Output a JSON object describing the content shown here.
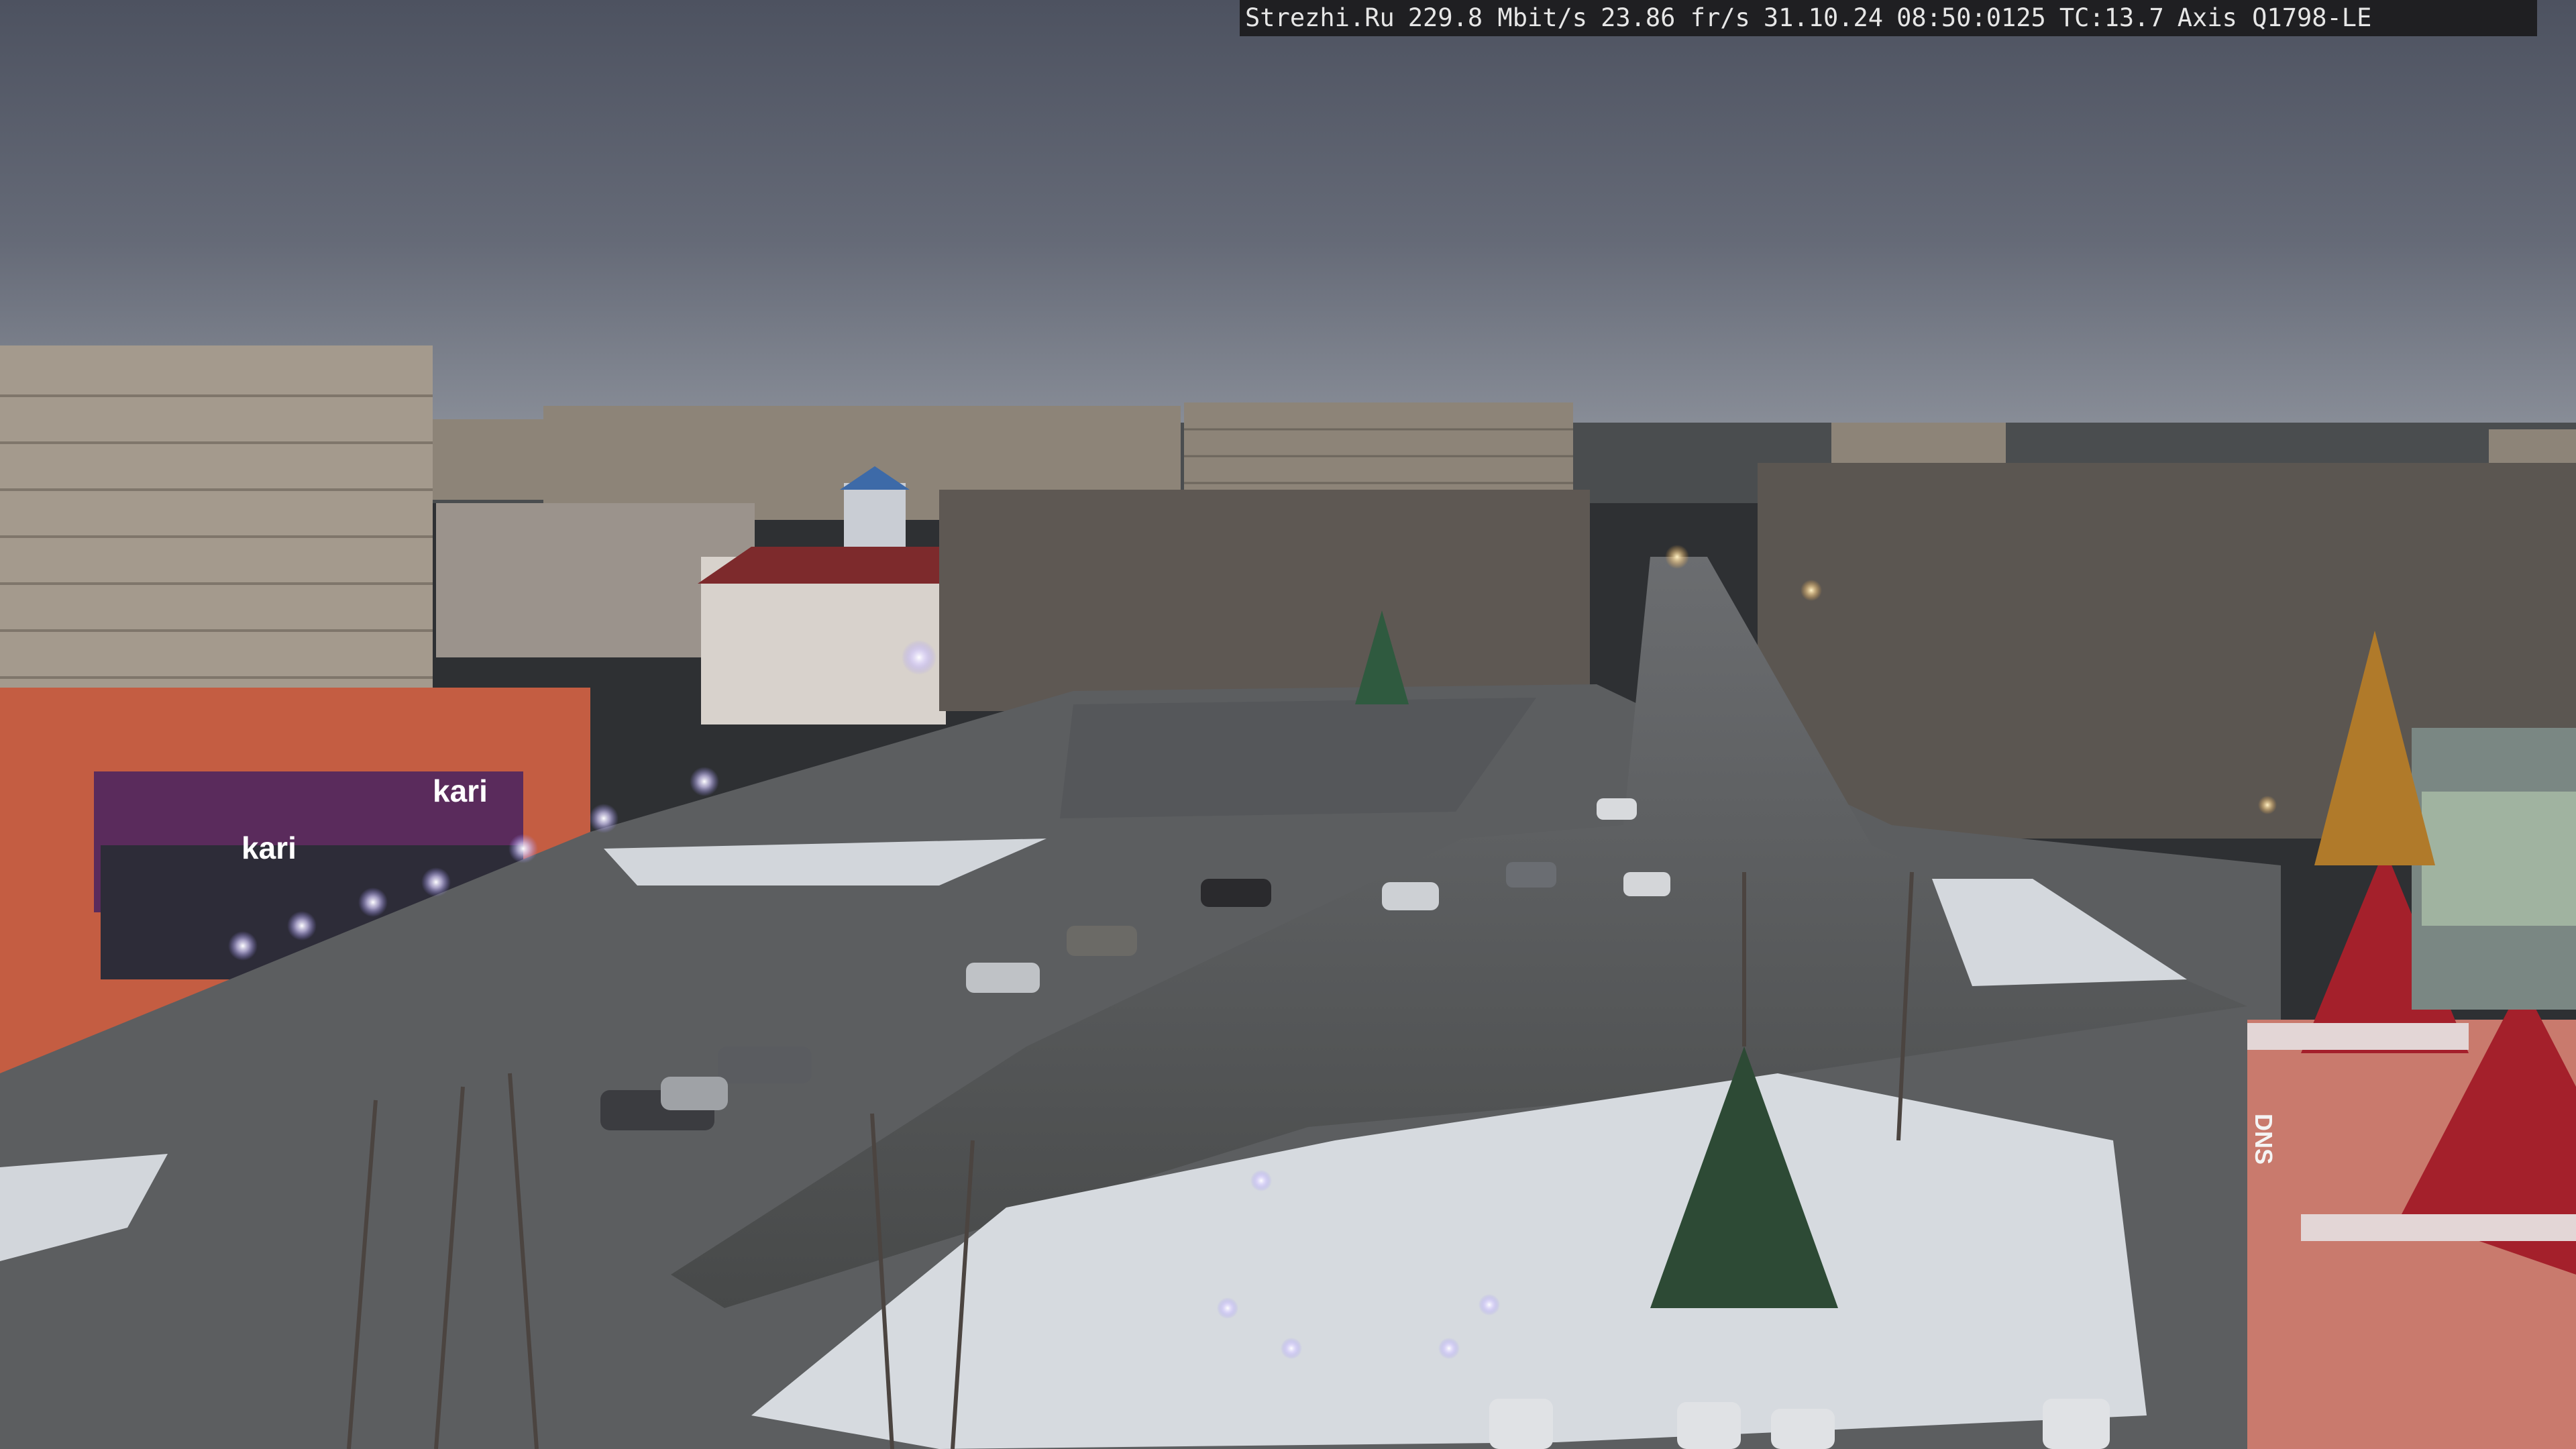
{
  "overlay": {
    "site": "Strezhi.Ru",
    "bitrate": "229.8 Mbit/s",
    "framerate": "23.86 fr/s",
    "date": "31.10.24",
    "time": "08:50:0125",
    "tc": "TC:13.7",
    "camera": "Axis Q1798-LE"
  },
  "signage": {
    "store_left": "kari",
    "store_left_2": "kari",
    "store_right": "DNS"
  },
  "colors": {
    "sky": "#5f6472",
    "road": "#4e5052",
    "snow": "#d9dde2",
    "brick": "#c0553f",
    "roof_red": "#a4202b"
  }
}
